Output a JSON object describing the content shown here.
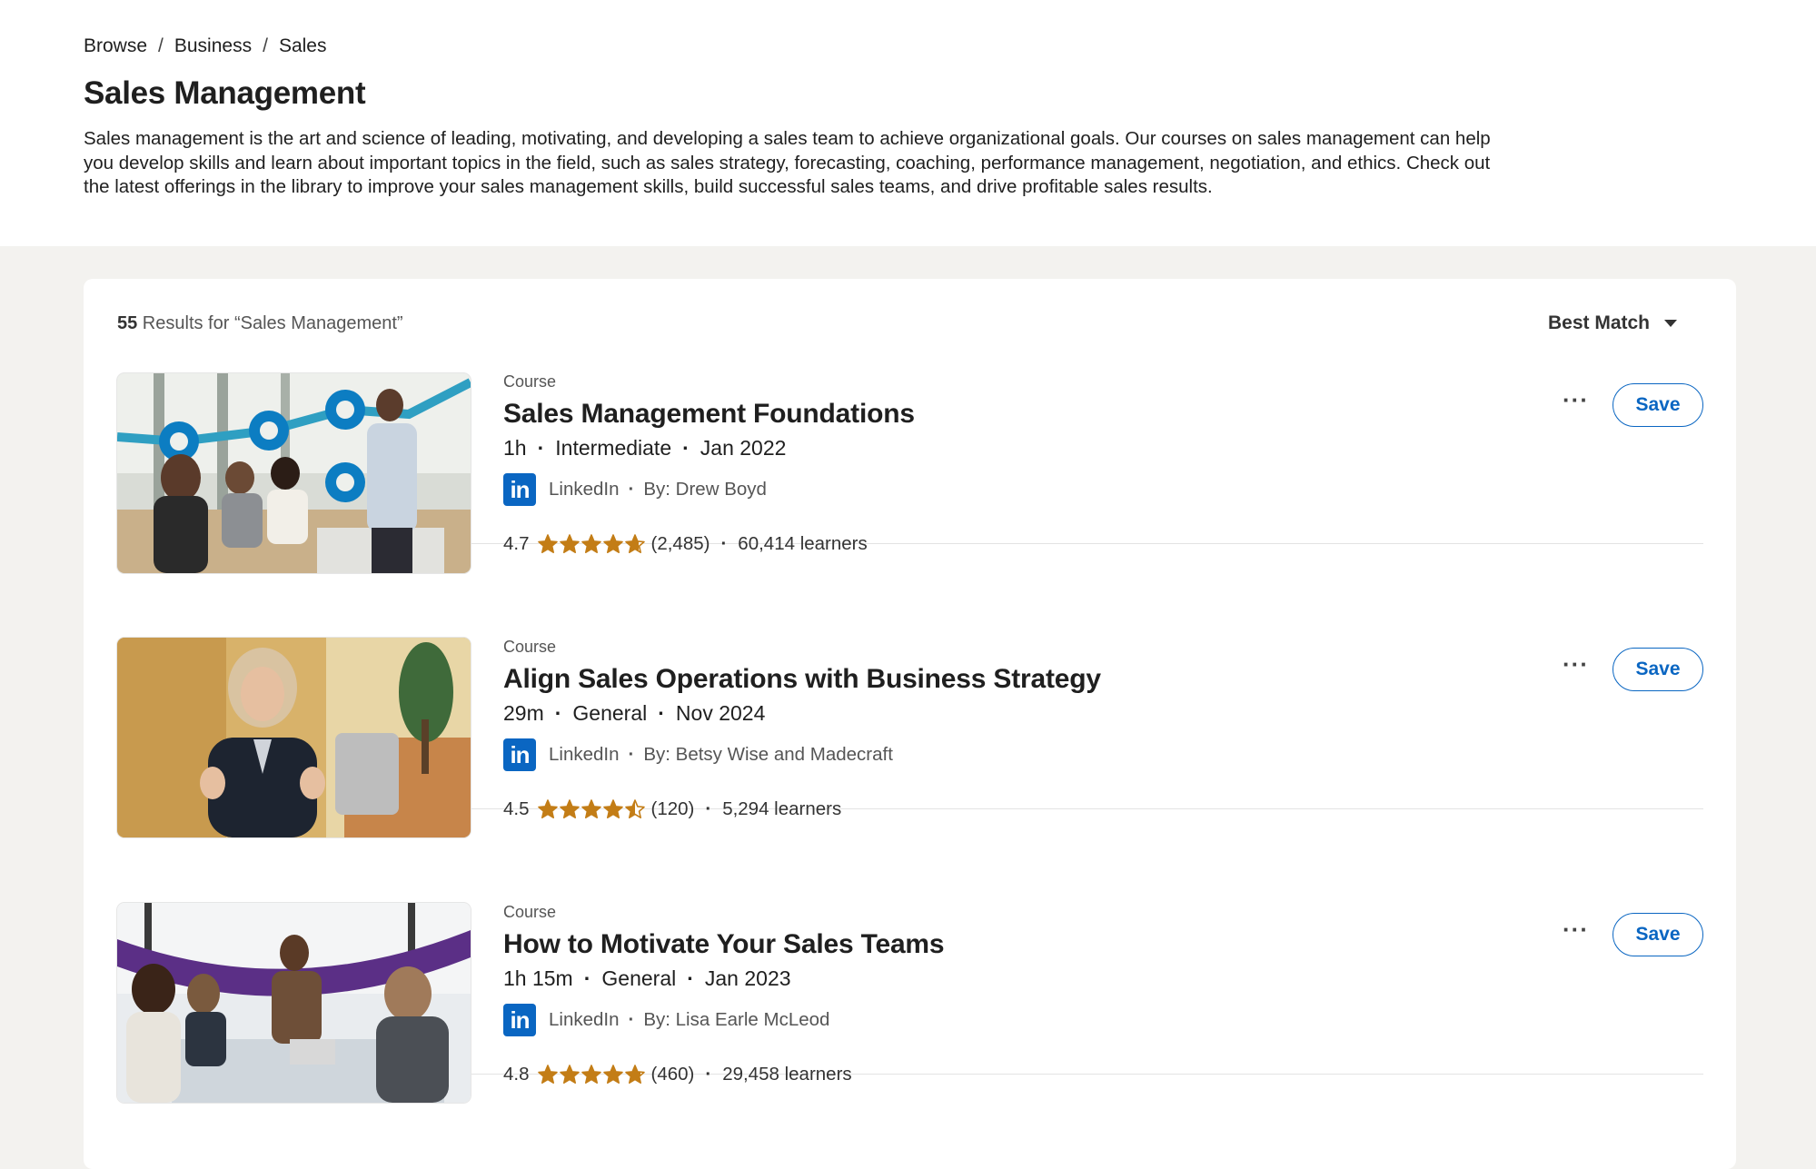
{
  "breadcrumb": [
    "Browse",
    "Business",
    "Sales"
  ],
  "page_title": "Sales Management",
  "description": "Sales management is the art and science of leading, motivating, and developing a sales team to achieve organizational goals. Our courses on sales management can help you develop skills and learn about important topics in the field, such as sales strategy, forecasting, coaching, performance management, negotiation, and ethics. Check out the latest offerings in the library to improve your sales management skills, build successful sales teams, and drive profitable sales results.",
  "results": {
    "count": "55",
    "label": " Results for “Sales Management”",
    "sort_label": "Best Match"
  },
  "colors": {
    "brand_blue": "#0a66c2",
    "star": "#c37d16"
  },
  "items": [
    {
      "type": "Course",
      "title": "Sales Management Foundations",
      "duration": "1h",
      "level": "Intermediate",
      "date": "Jan 2022",
      "provider": "LinkedIn",
      "author": "By: Drew Boyd",
      "rating": "4.7",
      "stars": 4.7,
      "reviews": "(2,485)",
      "learners": "60,414 learners",
      "save": "Save",
      "more": "···"
    },
    {
      "type": "Course",
      "title": "Align Sales Operations with Business Strategy",
      "duration": "29m",
      "level": "General",
      "date": "Nov 2024",
      "provider": "LinkedIn",
      "author": "By: Betsy Wise and Madecraft",
      "rating": "4.5",
      "stars": 4.5,
      "reviews": "(120)",
      "learners": "5,294 learners",
      "save": "Save",
      "more": "···"
    },
    {
      "type": "Course",
      "title": "How to Motivate Your Sales Teams",
      "duration": "1h 15m",
      "level": "General",
      "date": "Jan 2023",
      "provider": "LinkedIn",
      "author": "By: Lisa Earle McLeod",
      "rating": "4.8",
      "stars": 4.8,
      "reviews": "(460)",
      "learners": "29,458 learners",
      "save": "Save",
      "more": "···"
    }
  ]
}
